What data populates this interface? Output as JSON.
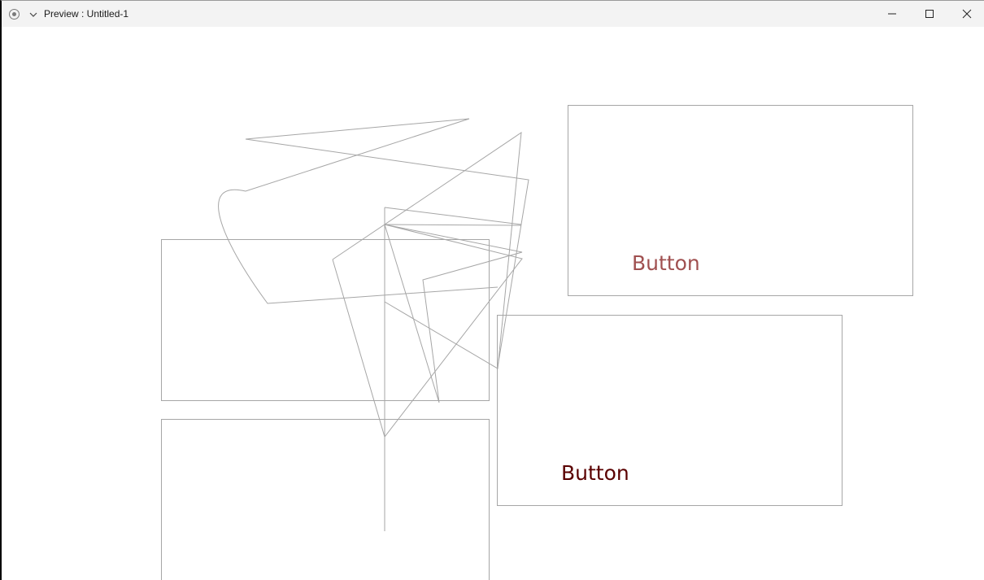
{
  "window": {
    "title": "Preview : Untitled-1"
  },
  "titlebar_icons": {
    "app": "record-icon",
    "menu": "chevron-down-icon",
    "minimize": "minimize-icon",
    "maximize": "maximize-icon",
    "close": "close-icon"
  },
  "canvas": {
    "buttons": [
      {
        "label": "Button",
        "color": "#a05050"
      },
      {
        "label": "Button",
        "color": "#5a0000"
      }
    ],
    "colors": {
      "stroke": "#a6a6a6",
      "background": "#ffffff"
    }
  }
}
